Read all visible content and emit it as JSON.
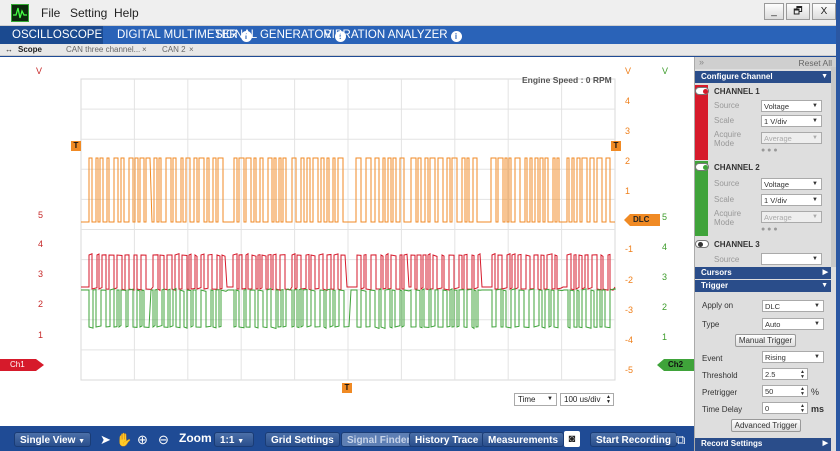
{
  "menu": {
    "file": "File",
    "setting": "Setting",
    "help": "Help"
  },
  "window": {
    "minimize": "_",
    "restore": "🗗",
    "close": "X"
  },
  "tabs": [
    {
      "label": "OSCILLOSCOPE"
    },
    {
      "label": "DIGITAL MULTIMETER"
    },
    {
      "label": "SIGNAL GENERATOR"
    },
    {
      "label": "VIBRATION ANALYZER"
    }
  ],
  "subtabs": {
    "scope": "Scope",
    "tab2": "CAN three channel...",
    "tab3": "CAN 2"
  },
  "plot": {
    "left_axis_unit": "V",
    "left_ticks": [
      "5",
      "4",
      "3",
      "2",
      "1"
    ],
    "ch1_axis_unit": "V",
    "ch1_ticks": [
      "4",
      "3",
      "2",
      "1",
      "-1",
      "-2",
      "-3",
      "-4",
      "-5"
    ],
    "ch2_axis_unit": "V",
    "ch2_ticks": [
      "5",
      "4",
      "3",
      "2",
      "1"
    ],
    "engine_speed": "Engine Speed :  0   RPM",
    "trigger_marker": "T",
    "dlc_marker": "DLC",
    "ch1_marker": "Ch1",
    "ch2_marker": "Ch2",
    "time_label": "Time",
    "time_scale": "100 us/div"
  },
  "bottom": {
    "single_view": "Single View",
    "zoom_label": "Zoom",
    "zoom_value": "1:1",
    "grid_settings": "Grid Settings",
    "signal_finder": "Signal Finder",
    "history_trace": "History Trace",
    "measurements": "Measurements",
    "start_recording": "Start Recording"
  },
  "panel": {
    "reset_all": "Reset All",
    "configure_channel": "Configure Channel",
    "ch1": {
      "name": "CHANNEL 1",
      "source_label": "Source",
      "source": "Voltage",
      "scale_label": "Scale",
      "scale": "1 V/div",
      "acquire_label": "Acquire Mode",
      "acquire": "Average",
      "color": "#d61a2b"
    },
    "ch2": {
      "name": "CHANNEL 2",
      "source_label": "Source",
      "source": "Voltage",
      "scale_label": "Scale",
      "scale": "1 V/div",
      "acquire_label": "Acquire Mode",
      "acquire": "Average",
      "color": "#3fa33a"
    },
    "ch3": {
      "name": "CHANNEL 3",
      "source_label": "Source"
    },
    "cursors": "Cursors",
    "trigger": "Trigger",
    "apply_on_label": "Apply on",
    "apply_on": "DLC",
    "type_label": "Type",
    "type": "Auto",
    "manual_trigger": "Manual Trigger",
    "event_label": "Event",
    "event": "Rising",
    "threshold_label": "Threshold",
    "threshold": "2.5",
    "pretrigger_label": "Pretrigger",
    "pretrigger": "50",
    "pretrigger_unit": "%",
    "time_delay_label": "Time Delay",
    "time_delay": "0",
    "time_delay_unit": "ms",
    "advanced_trigger": "Advanced Trigger",
    "record_settings": "Record Settings"
  },
  "colors": {
    "orange": "#f08a24",
    "red": "#d61a2b",
    "green": "#3fa33a",
    "accent": "#2a63b8"
  }
}
